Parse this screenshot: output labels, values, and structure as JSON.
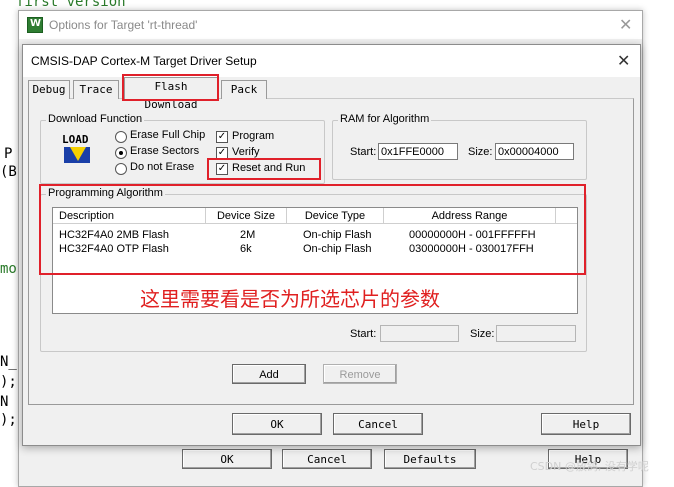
{
  "background_code": {
    "top": "first version",
    "left_fragments": [
      "P",
      "(B",
      "mo",
      "N_",
      ");",
      "N",
      "); "
    ]
  },
  "outer_dialog": {
    "title": "Options for Target 'rt-thread'",
    "icon_letter": "W"
  },
  "inner_dialog": {
    "title": "CMSIS-DAP Cortex-M Target Driver Setup"
  },
  "tabs": [
    {
      "label": "Debug"
    },
    {
      "label": "Trace"
    },
    {
      "label": "Flash Download"
    },
    {
      "label": "Pack"
    }
  ],
  "download_function": {
    "legend": "Download Function",
    "load_icon_text": "LOAD",
    "radios": [
      {
        "label": "Erase Full Chip",
        "selected": false
      },
      {
        "label": "Erase Sectors",
        "selected": true
      },
      {
        "label": "Do not Erase",
        "selected": false
      }
    ],
    "checks": [
      {
        "label": "Program",
        "checked": true
      },
      {
        "label": "Verify",
        "checked": true
      },
      {
        "label": "Reset and Run",
        "checked": true
      }
    ]
  },
  "ram_for_algorithm": {
    "legend": "RAM for Algorithm",
    "start_label": "Start:",
    "start_value": "0x1FFE0000",
    "size_label": "Size:",
    "size_value": "0x00004000"
  },
  "programming_algorithm": {
    "legend": "Programming Algorithm",
    "columns": [
      "Description",
      "Device Size",
      "Device Type",
      "Address Range"
    ],
    "rows": [
      [
        "HC32F4A0 2MB Flash",
        "2M",
        "On-chip Flash",
        "00000000H - 001FFFFFH"
      ],
      [
        "HC32F4A0 OTP Flash",
        "6k",
        "On-chip Flash",
        "03000000H - 030017FFH"
      ]
    ],
    "start_label": "Start:",
    "size_label": "Size:",
    "add_label": "Add",
    "remove_label": "Remove"
  },
  "annotation": "这里需要看是否为所选芯片的参数",
  "inner_buttons": {
    "ok": "OK",
    "cancel": "Cancel",
    "help": "Help"
  },
  "outer_buttons": {
    "ok": "OK",
    "cancel": "Cancel",
    "defaults": "Defaults",
    "help": "Help"
  },
  "watermark": "CSDN @放鸽, 没有学呢",
  "colors": {
    "accent_red": "#e0202a",
    "dialog_bg": "#f0f0f0"
  }
}
